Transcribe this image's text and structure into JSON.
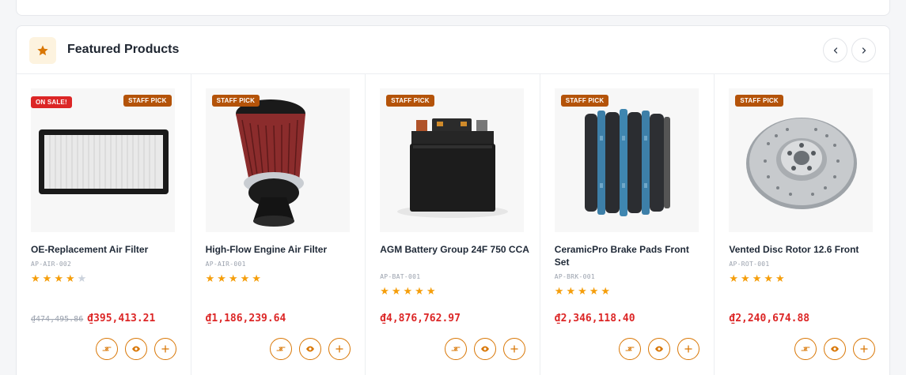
{
  "section": {
    "title": "Featured Products",
    "star_icon": "star-icon",
    "nav_prev_icon": "chevron-left-icon",
    "nav_next_icon": "chevron-right-icon",
    "accent_color": "#d97706",
    "sale_color": "#dc2626"
  },
  "products": [
    {
      "name": "OE-Replacement Air Filter",
      "sku": "AP-AIR-002",
      "rating": 4,
      "old_price": "₫474,495.86",
      "price": "₫395,413.21",
      "sale_badge": "ON SALE!",
      "pick_badge": "STAFF PICK",
      "image": "air-filter-panel"
    },
    {
      "name": "High-Flow Engine Air Filter",
      "sku": "AP-AIR-001",
      "rating": 5,
      "old_price": "",
      "price": "₫1,186,239.64",
      "sale_badge": "",
      "pick_badge": "STAFF PICK",
      "image": "cone-air-filter"
    },
    {
      "name": "AGM Battery Group 24F 750 CCA",
      "sku": "AP-BAT-001",
      "rating": 5,
      "old_price": "",
      "price": "₫4,876,762.97",
      "sale_badge": "",
      "pick_badge": "STAFF PICK",
      "image": "car-battery"
    },
    {
      "name": "CeramicPro Brake Pads Front Set",
      "sku": "AP-BRK-001",
      "rating": 5,
      "old_price": "",
      "price": "₫2,346,118.40",
      "sale_badge": "",
      "pick_badge": "STAFF PICK",
      "image": "brake-pads"
    },
    {
      "name": "Vented Disc Rotor 12.6 Front",
      "sku": "AP-ROT-001",
      "rating": 5,
      "old_price": "",
      "price": "₫2,240,674.88",
      "sale_badge": "",
      "pick_badge": "STAFF PICK",
      "image": "disc-rotor"
    }
  ],
  "actions": {
    "compare_icon": "compare-icon",
    "quick_view_icon": "eye-icon",
    "add_icon": "plus-icon"
  }
}
